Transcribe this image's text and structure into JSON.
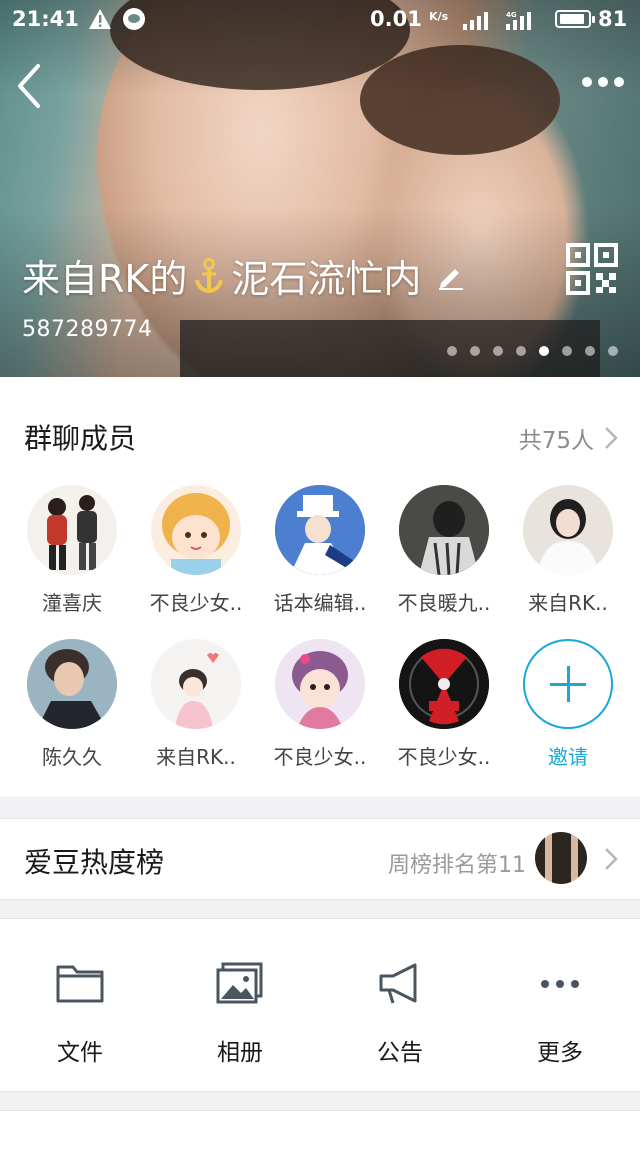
{
  "status": {
    "time": "21:41",
    "net_speed": "0.01",
    "net_unit": "K/s",
    "battery": "81"
  },
  "header": {
    "group_name_part1": "来自RK的",
    "group_name_part2": "泥石流忙内",
    "group_id": "587289774",
    "carousel_total": 8,
    "carousel_active": 5
  },
  "members": {
    "title": "群聊成员",
    "count_label": "共75人",
    "list": [
      {
        "name": "潼喜庆"
      },
      {
        "name": "不良少女.."
      },
      {
        "name": "话本编辑.."
      },
      {
        "name": "不良暖九.."
      },
      {
        "name": "来自RK.."
      },
      {
        "name": "陈久久"
      },
      {
        "name": "来自RK.."
      },
      {
        "name": "不良少女.."
      },
      {
        "name": "不良少女.."
      }
    ],
    "invite_label": "邀请"
  },
  "idol_rank": {
    "title": "爱豆热度榜",
    "value": "周榜排名第11"
  },
  "actions": [
    {
      "label": "文件",
      "icon": "folder-icon"
    },
    {
      "label": "相册",
      "icon": "album-icon"
    },
    {
      "label": "公告",
      "icon": "megaphone-icon"
    },
    {
      "label": "更多",
      "icon": "more-icon"
    }
  ],
  "colors": {
    "accent": "#19a8d8",
    "header_bg": "#6a8c89"
  }
}
